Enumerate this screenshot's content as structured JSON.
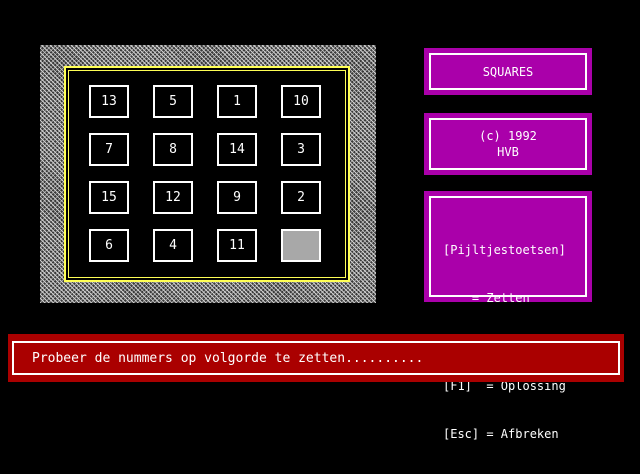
{
  "board": {
    "tiles": [
      [
        "13",
        "5",
        "1",
        "10"
      ],
      [
        "7",
        "8",
        "14",
        "3"
      ],
      [
        "15",
        "12",
        "9",
        "2"
      ],
      [
        "6",
        "4",
        "11",
        ""
      ]
    ],
    "blank_position": "row 4, column 4"
  },
  "title_panel": {
    "title": "SQUARES"
  },
  "copyright_panel": {
    "line1": "(c) 1992",
    "line2": "HVB"
  },
  "help_panel": {
    "line1": "[Pijltjestoetsen]",
    "line2": "    = Zetten",
    "line3": "[F1]  = Oplossing",
    "line4": "[Esc] = Afbreken"
  },
  "status": {
    "message": "Probeer de nummers op volgorde te zetten.........."
  },
  "colors": {
    "panel_magenta": "#aa00aa",
    "status_red": "#aa0000",
    "board_border_yellow": "#ffff55",
    "blank_tile_gray": "#a8a8a8"
  }
}
